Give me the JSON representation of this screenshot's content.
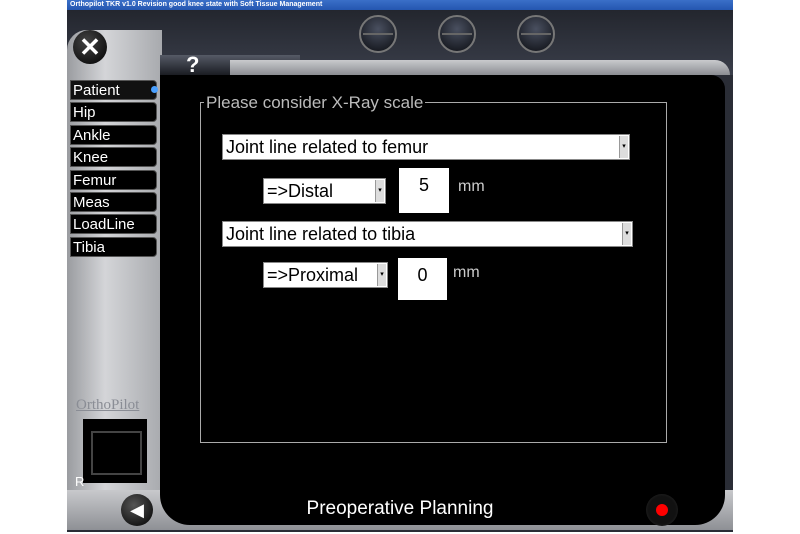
{
  "window": {
    "title": "Orthopilot TKR v1.0 Revision good knee state with Soft Tissue Management"
  },
  "toolbar": {
    "close_icon": "x-icon",
    "help_label": "?"
  },
  "sidebar": {
    "items": [
      {
        "label": "Patient",
        "selected": true
      },
      {
        "label": "Hip"
      },
      {
        "label": "Ankle"
      },
      {
        "label": "Knee"
      },
      {
        "label": "Femur"
      },
      {
        "label": "Meas"
      },
      {
        "label": "LoadLine"
      },
      {
        "label": "Tibia"
      }
    ],
    "logo": "OrthoPilot",
    "side_label": "R"
  },
  "main": {
    "group_title": "Please consider X-Ray scale",
    "femur": {
      "select": "Joint line related to femur",
      "direction": "=>Distal",
      "value": "5",
      "unit": "mm"
    },
    "tibia": {
      "select": "Joint line related to tibia",
      "direction": "=>Proximal",
      "value": "0",
      "unit": "mm"
    }
  },
  "footer": {
    "status": "Preoperative Planning"
  },
  "colors": {
    "accent": "#4aa0ff",
    "record": "#ff0000"
  }
}
